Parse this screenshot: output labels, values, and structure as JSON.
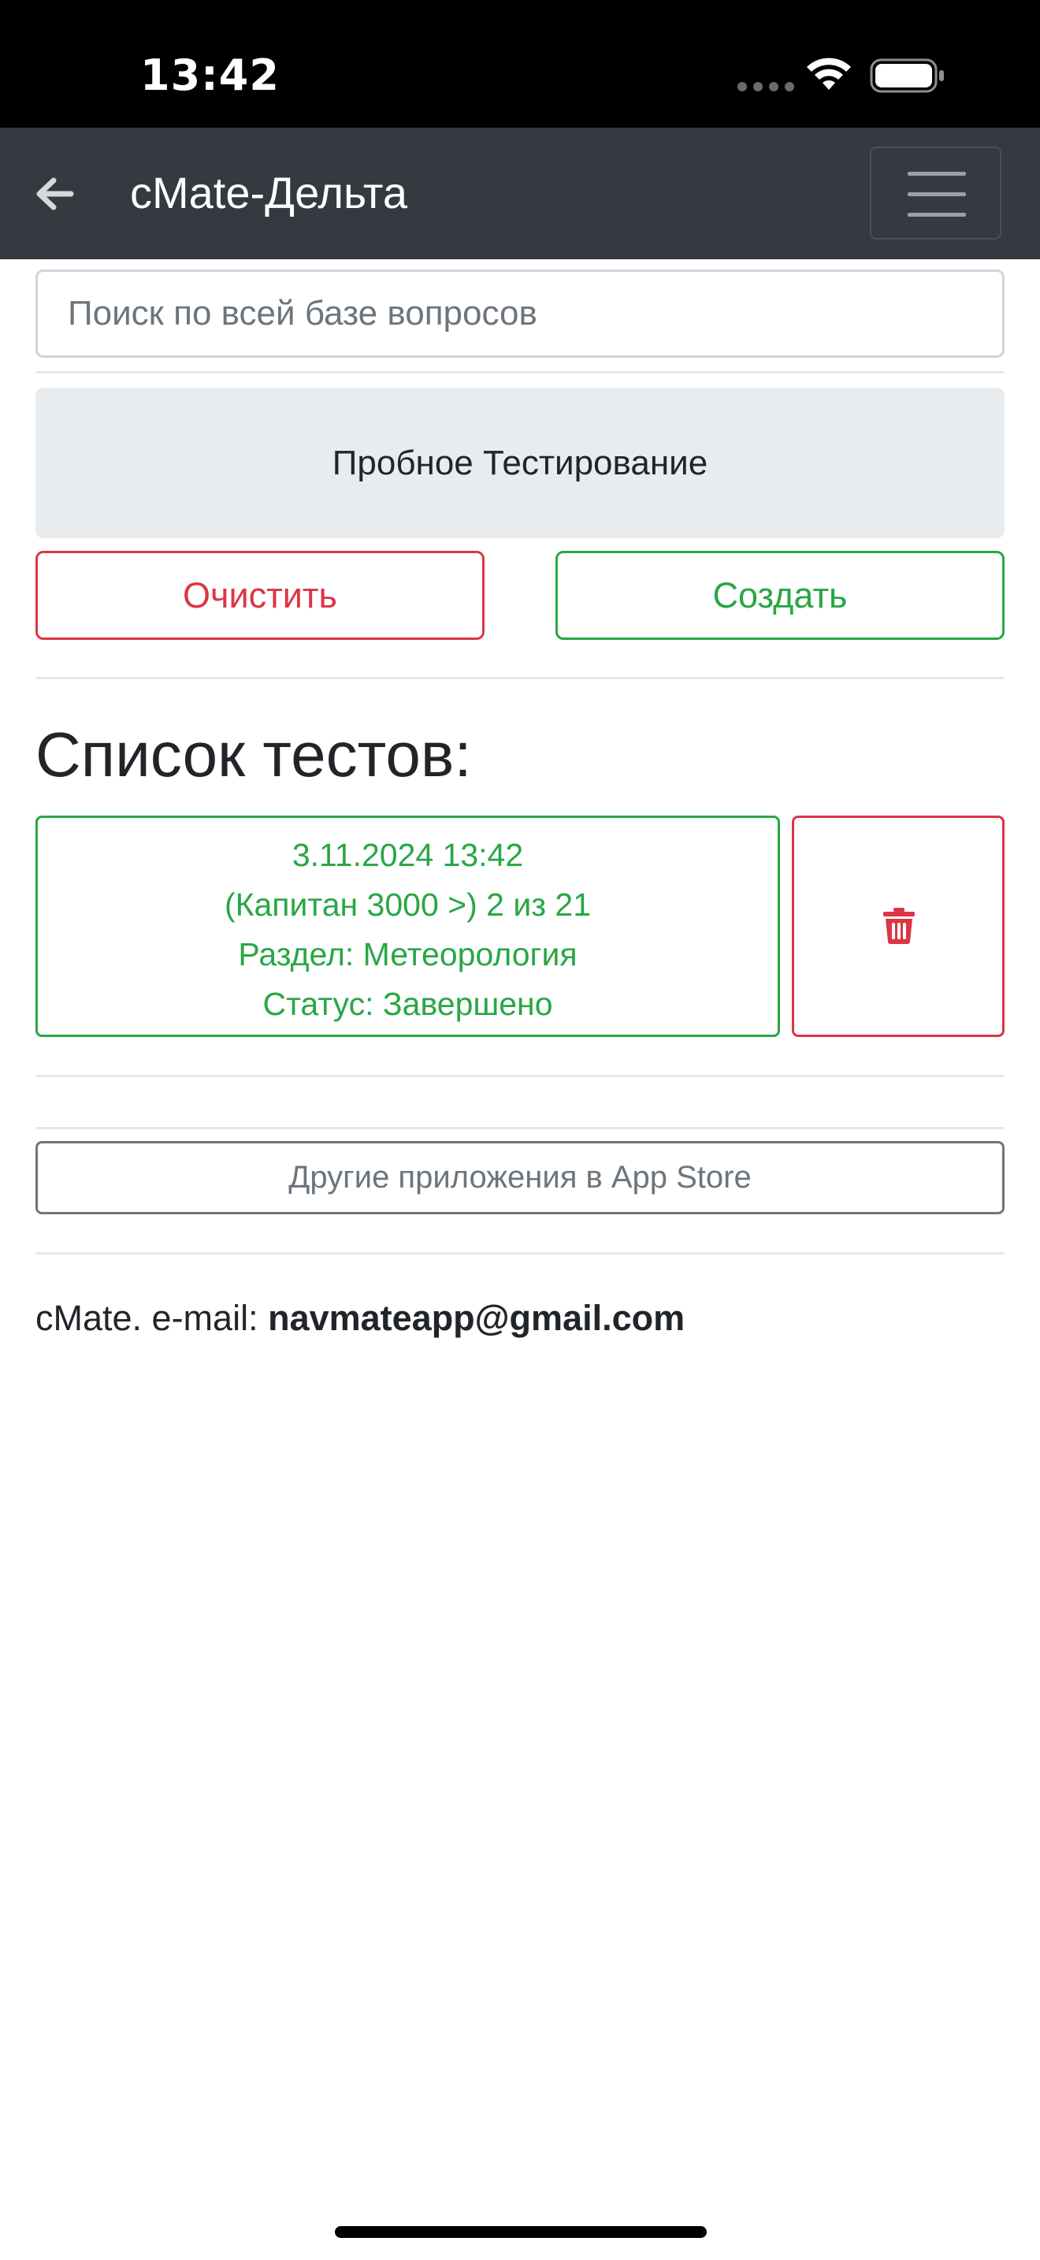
{
  "status_bar": {
    "time": "13:42",
    "icons": [
      "cellular-dots-icon",
      "wifi-icon",
      "battery-icon"
    ]
  },
  "navbar": {
    "back_icon": "arrow-left-icon",
    "title": "cMate-Дельта",
    "menu_icon": "hamburger-menu-icon"
  },
  "search": {
    "placeholder": "Поиск по всей базе вопросов"
  },
  "mode": {
    "label": "Пробное Тестирование"
  },
  "actions": {
    "clear_label": "Очистить",
    "create_label": "Создать"
  },
  "tests": {
    "heading": "Список тестов:",
    "items": [
      {
        "date": "3.11.2024 13:42",
        "progress": "(Капитан 3000 >) 2 из 21",
        "section": "Раздел: Метеорология",
        "status": "Статус: Завершено",
        "delete_icon": "trash-icon"
      }
    ]
  },
  "store": {
    "label": "Другие приложения в App Store"
  },
  "footer": {
    "prefix": "cMate. e-mail: ",
    "email": "navmateapp@gmail.com"
  },
  "colors": {
    "navbar_bg": "#343a40",
    "danger": "#dc3545",
    "success": "#28a745",
    "secondary": "#6c757d"
  }
}
